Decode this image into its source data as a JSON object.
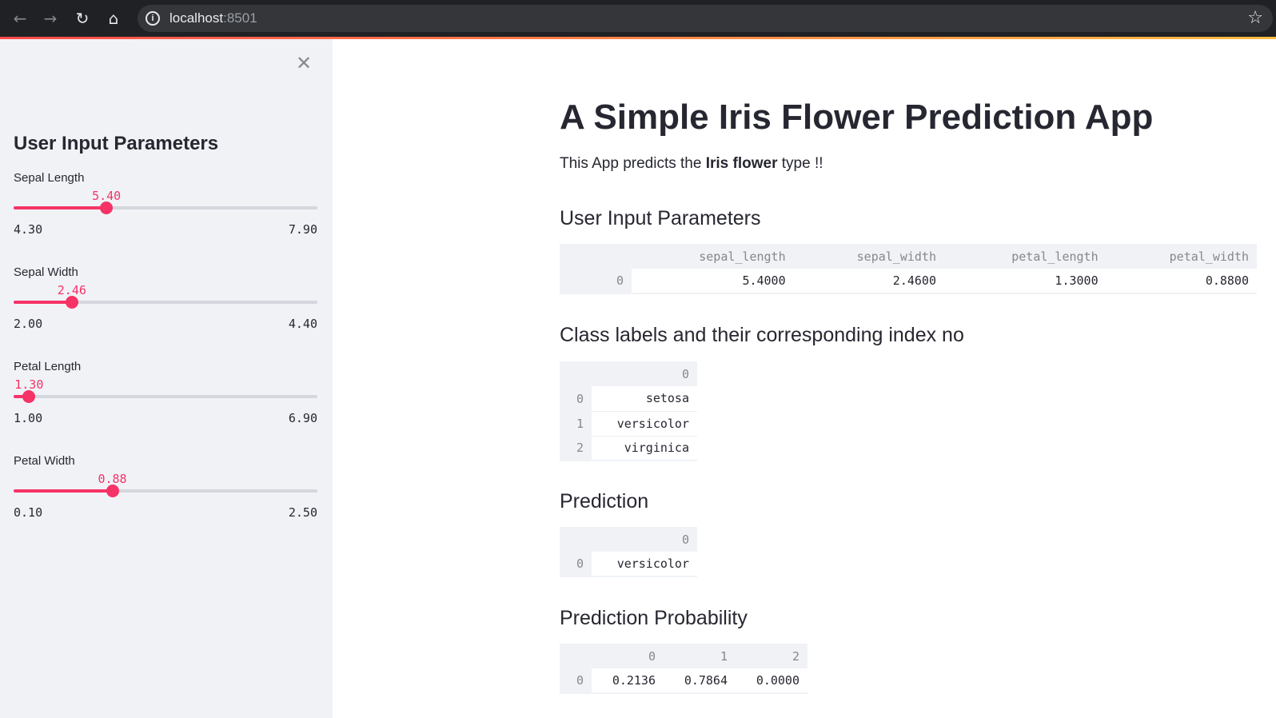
{
  "browser": {
    "url_host": "localhost",
    "url_port": ":8501"
  },
  "sidebar": {
    "title": "User Input Parameters",
    "sliders": [
      {
        "label": "Sepal Length",
        "value": "5.40",
        "min": "4.30",
        "max": "7.90",
        "fraction": 0.3056
      },
      {
        "label": "Sepal Width",
        "value": "2.46",
        "min": "2.00",
        "max": "4.40",
        "fraction": 0.1917
      },
      {
        "label": "Petal Length",
        "value": "1.30",
        "min": "1.00",
        "max": "6.90",
        "fraction": 0.0508
      },
      {
        "label": "Petal Width",
        "value": "0.88",
        "min": "0.10",
        "max": "2.50",
        "fraction": 0.325
      }
    ]
  },
  "main": {
    "title": "A Simple Iris Flower Prediction App",
    "intro_prefix": "This App predicts the ",
    "intro_bold": "Iris flower",
    "intro_suffix": " type !!",
    "input_section": {
      "heading": "User Input Parameters",
      "columns": [
        "sepal_length",
        "sepal_width",
        "petal_length",
        "petal_width"
      ],
      "rows": [
        {
          "index": "0",
          "values": [
            "5.4000",
            "2.4600",
            "1.3000",
            "0.8800"
          ]
        }
      ]
    },
    "labels_section": {
      "heading": "Class labels and their corresponding index no",
      "column": "0",
      "rows": [
        {
          "index": "0",
          "value": "setosa"
        },
        {
          "index": "1",
          "value": "versicolor"
        },
        {
          "index": "2",
          "value": "virginica"
        }
      ]
    },
    "prediction_section": {
      "heading": "Prediction",
      "column": "0",
      "rows": [
        {
          "index": "0",
          "value": "versicolor"
        }
      ]
    },
    "probability_section": {
      "heading": "Prediction Probability",
      "columns": [
        "0",
        "1",
        "2"
      ],
      "rows": [
        {
          "index": "0",
          "values": [
            "0.2136",
            "0.7864",
            "0.0000"
          ]
        }
      ]
    }
  },
  "colors": {
    "accent": "#f63366",
    "sidebar_bg": "#f0f2f6",
    "chrome_bg": "#202124"
  }
}
